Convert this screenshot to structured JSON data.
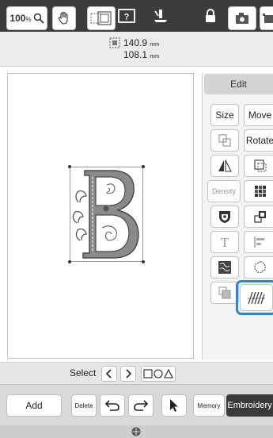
{
  "status_bar": {
    "icons": [
      "wifi-icon",
      "camera-icon",
      "document-icon",
      "help-icon",
      "thread-icon",
      "lock-icon",
      "home-icon"
    ]
  },
  "toolbar": {
    "zoom_value": "100",
    "zoom_unit": "%",
    "icons": [
      "magnifier-icon",
      "hand-pan-icon",
      "frame-select-icon",
      "camera-icon",
      "camera-settings-icon"
    ],
    "width_value": "140.9",
    "height_value": "108.1",
    "unit": "mm"
  },
  "canvas": {
    "design": "embroidered-letter-B"
  },
  "edit_panel": {
    "header": "Edit",
    "size_label": "Size",
    "move_label": "Move",
    "rotate_label": "Rotate",
    "density_label": "Density",
    "highlighted_tool": "stitch-edit-icon",
    "icons": [
      "group-icon",
      "flip-icon",
      "border-icon",
      "color-grid-icon",
      "applique-icon",
      "multicolor-icon",
      "text-icon",
      "align-icon",
      "stipple-icon",
      "outline-icon",
      "duplicate-icon",
      "stitch-edit-icon"
    ]
  },
  "select_row": {
    "label": "Select",
    "prev_icon": "chevron-left-icon",
    "next_icon": "chevron-right-icon",
    "shapes_icon": "shape-select-icon"
  },
  "bottom_bar": {
    "add_label": "Add",
    "delete_label": "Delete",
    "memory_label": "Memory",
    "embroidery_label": "Embroidery",
    "undo_icon": "undo-icon",
    "redo_icon": "redo-icon",
    "pointer_icon": "pointer-icon"
  },
  "footer": {
    "icon": "settings-icon"
  },
  "colors": {
    "top_bar": "#3c3c3c",
    "highlight": "#2a86d8",
    "embroidery_button": "#3a3a3a"
  }
}
